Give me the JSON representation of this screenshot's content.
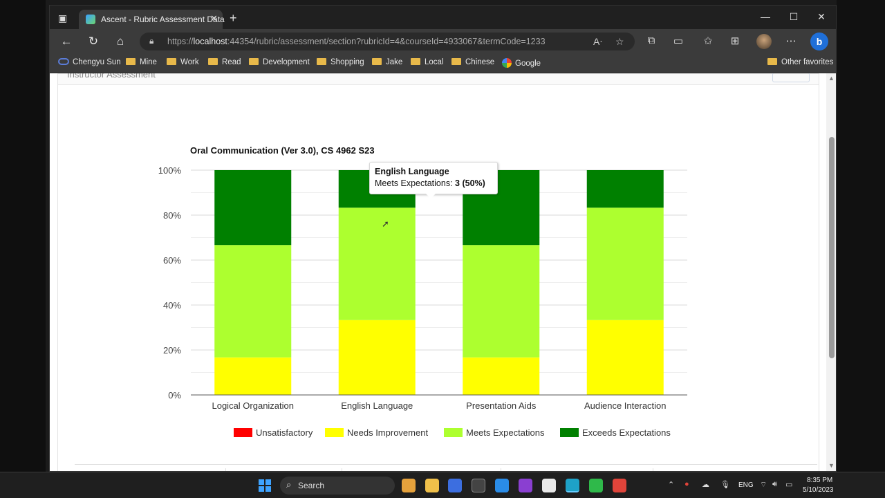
{
  "browser": {
    "tab_title": "Ascent - Rubric Assessment Data",
    "url_prefix": "https://",
    "url_host": "localhost",
    "url_rest": ":44354/rubric/assessment/section?rubricId=4&courseId=4933067&termCode=1233"
  },
  "favorites": {
    "items": [
      "Chengyu Sun",
      "Mine",
      "Work",
      "Read",
      "Development",
      "Shopping",
      "Jake",
      "Local",
      "Chinese",
      "Google"
    ],
    "other": "Other favorites"
  },
  "panel": {
    "header": "Instructor Assessment"
  },
  "chart_data": {
    "type": "bar",
    "stacked": true,
    "title": "Oral Communication (Ver 3.0), CS 4962 S23",
    "categories": [
      "Logical Organization",
      "English Language",
      "Presentation Aids",
      "Audience Interaction"
    ],
    "yticks": [
      "0%",
      "20%",
      "40%",
      "60%",
      "80%",
      "100%"
    ],
    "ylim": [
      0,
      100
    ],
    "legend_position": "bottom",
    "grid": true,
    "series": [
      {
        "name": "Unsatisfactory",
        "color": "#ff0000",
        "values": [
          0,
          0,
          0,
          0
        ]
      },
      {
        "name": "Needs Improvement",
        "color": "#ffff00",
        "values": [
          16.7,
          33.3,
          16.7,
          33.3
        ]
      },
      {
        "name": "Meets Expectations",
        "color": "#adff2f",
        "values": [
          50,
          50,
          50,
          50
        ]
      },
      {
        "name": "Exceeds Expectations",
        "color": "#008000",
        "values": [
          33.3,
          16.7,
          33.3,
          16.7
        ]
      }
    ]
  },
  "tooltip": {
    "title": "English Language",
    "label": "Meets Expectations: ",
    "value": "3 (50%)"
  },
  "taskbar": {
    "search": "Search",
    "lang": "ENG",
    "time": "8:35 PM",
    "date": "5/10/2023"
  }
}
